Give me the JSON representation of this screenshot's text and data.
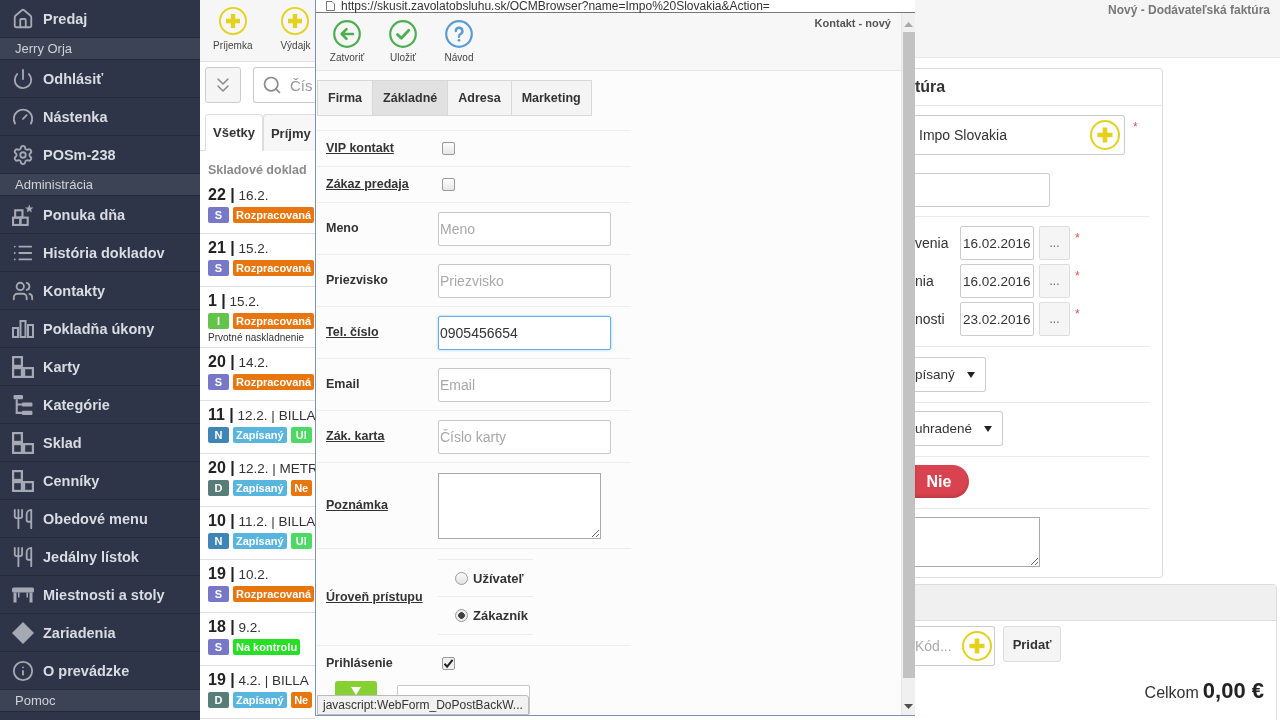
{
  "sidebar": {
    "groups": [
      {
        "items": [
          {
            "label": "Predaj"
          }
        ]
      },
      {
        "heading": "Jerry Orja",
        "items": [
          {
            "label": "Odhlásiť"
          },
          {
            "label": "Nástenka"
          },
          {
            "label": "POSm-238"
          }
        ]
      },
      {
        "heading": "Administrácia",
        "items": [
          {
            "label": "Ponuka dňa"
          },
          {
            "label": "História dokladov"
          },
          {
            "label": "Kontakty"
          },
          {
            "label": "Pokladňa úkony"
          },
          {
            "label": "Karty"
          },
          {
            "label": "Kategórie"
          },
          {
            "label": "Sklad"
          },
          {
            "label": "Cenníky"
          },
          {
            "label": "Obedové menu"
          },
          {
            "label": "Jedálny lístok"
          },
          {
            "label": "Miestnosti a stoly"
          },
          {
            "label": "Zariadenia"
          },
          {
            "label": "O prevádzke"
          }
        ]
      },
      {
        "heading": "Pomoc"
      }
    ]
  },
  "documents": {
    "toolbar": [
      {
        "label": "Príjemka"
      },
      {
        "label": "Výdajk"
      }
    ],
    "search": {
      "placeholder": "Čís"
    },
    "tabs": [
      {
        "label": "Všetky",
        "selected": true
      },
      {
        "label": "Príjmy",
        "selected": false
      }
    ],
    "heading": "Skladové doklad",
    "rows": [
      {
        "title": "**22 |** 16.2.",
        "badges": [
          {
            "text": "S",
            "color": "#7878c8"
          },
          {
            "text": "Rozpracovaná",
            "color": "#e8760f"
          }
        ]
      },
      {
        "title": "**21 |** 15.2.",
        "badges": [
          {
            "text": "S",
            "color": "#7878c8"
          },
          {
            "text": "Rozpracovaná",
            "color": "#e8760f"
          }
        ]
      },
      {
        "title": "**1 |** 15.2.",
        "badges": [
          {
            "text": "I",
            "color": "#64c34a"
          },
          {
            "text": "Rozpracovaná",
            "color": "#e8760f"
          }
        ],
        "note": "Prvotné naskladnenie"
      },
      {
        "title": "**20 |** 14.2.",
        "badges": [
          {
            "text": "S",
            "color": "#7878c8"
          },
          {
            "text": "Rozpracovaná",
            "color": "#e8760f"
          }
        ]
      },
      {
        "title": "**11 |** 12.2. | BILLA",
        "badges": [
          {
            "text": "N",
            "color": "#3f86b6"
          },
          {
            "text": "Zapísaný",
            "color": "#58b5de"
          },
          {
            "text": "Ul",
            "color": "#4cd964"
          }
        ]
      },
      {
        "title": "**20 |** 12.2. | METR",
        "badges": [
          {
            "text": "D",
            "color": "#587d78"
          },
          {
            "text": "Zapísaný",
            "color": "#58b5de"
          },
          {
            "text": "Ne",
            "color": "#e8760f"
          }
        ]
      },
      {
        "title": "**10 |** 11.2. | BILLA",
        "badges": [
          {
            "text": "N",
            "color": "#3f86b6"
          },
          {
            "text": "Zapísaný",
            "color": "#58b5de"
          },
          {
            "text": "Ul",
            "color": "#4cd964"
          }
        ]
      },
      {
        "title": "**19 |** 10.2.",
        "badges": [
          {
            "text": "S",
            "color": "#7878c8"
          },
          {
            "text": "Rozpracovaná",
            "color": "#e8760f"
          }
        ]
      },
      {
        "title": "**18 |** 9.2.",
        "badges": [
          {
            "text": "S",
            "color": "#7878c8"
          },
          {
            "text": "Na kontrolu",
            "color": "#26df26"
          }
        ]
      },
      {
        "title": "**19 |** 4.2. | BILLA",
        "badges": [
          {
            "text": "D",
            "color": "#587d78"
          },
          {
            "text": "Zapísaný",
            "color": "#58b5de"
          },
          {
            "text": "Ne",
            "color": "#e8760f"
          }
        ]
      }
    ]
  },
  "dialog": {
    "address": "https://skusit.zavolatobsluhu.sk/OCMBrowser?name=Impo%20Slovakia&Action=",
    "title": "Kontakt - nový",
    "toolbar": [
      {
        "label": "Zatvoriť",
        "kind": "back"
      },
      {
        "label": "Uložiť",
        "kind": "save"
      },
      {
        "label": "Návod",
        "kind": "help"
      }
    ],
    "tabs": [
      {
        "label": "Firma",
        "selected": false
      },
      {
        "label": "Základné",
        "selected": true
      },
      {
        "label": "Adresa",
        "selected": false
      },
      {
        "label": "Marketing",
        "selected": false
      }
    ],
    "fields": [
      {
        "kind": "checkbox",
        "label": "VIP kontakt",
        "link": true,
        "checked": false
      },
      {
        "kind": "checkbox",
        "label": "Zákaz predaja",
        "link": true,
        "checked": false
      },
      {
        "kind": "text",
        "label": "Meno",
        "link": false,
        "placeholder": "Meno",
        "focused": false
      },
      {
        "kind": "text",
        "label": "Priezvisko",
        "link": false,
        "placeholder": "Priezvisko",
        "focused": false
      },
      {
        "kind": "text",
        "label": "Tel. číslo",
        "link": true,
        "value": "0905456654",
        "focused": true
      },
      {
        "kind": "text",
        "label": "Email",
        "link": false,
        "placeholder": "Email",
        "focused": false
      },
      {
        "kind": "text",
        "label": "Zák. karta",
        "link": true,
        "placeholder": "Číslo karty",
        "focused": false
      },
      {
        "kind": "textarea",
        "label": "Poznámka",
        "link": true
      },
      {
        "kind": "radio",
        "label": "Úroveň prístupu",
        "link": true,
        "options": [
          {
            "label": "Užívateľ",
            "selected": false
          },
          {
            "label": "Zákazník",
            "selected": true
          }
        ]
      },
      {
        "kind": "checkbox",
        "label": "Prihlásenie",
        "link": false,
        "checked": true
      }
    ],
    "status_tip": "javascript:WebForm_DoPostBackW..."
  },
  "invoice": {
    "page_title": "Nový - Dodávateľská faktúra",
    "form": {
      "title": "túra",
      "supplier": {
        "value": "Impo Slovakia",
        "mark": "*"
      },
      "dates": [
        {
          "label": "venia",
          "value": "16.02.2016",
          "button": "...",
          "mark": "*"
        },
        {
          "label": "nia",
          "value": "16.02.2016",
          "button": "...",
          "mark": "*"
        },
        {
          "label": "nosti",
          "value": "23.02.2016",
          "button": "...",
          "mark": "*"
        }
      ],
      "selects": [
        {
          "value": "písaný"
        },
        {
          "value": "uhradené"
        }
      ],
      "toggle": {
        "label": "Nie",
        "on": false
      }
    },
    "items": {
      "code_placeholder": "Kód...",
      "add_button": "Pridať",
      "total_label": "Celkom",
      "total_value": "0,00 €"
    }
  }
}
